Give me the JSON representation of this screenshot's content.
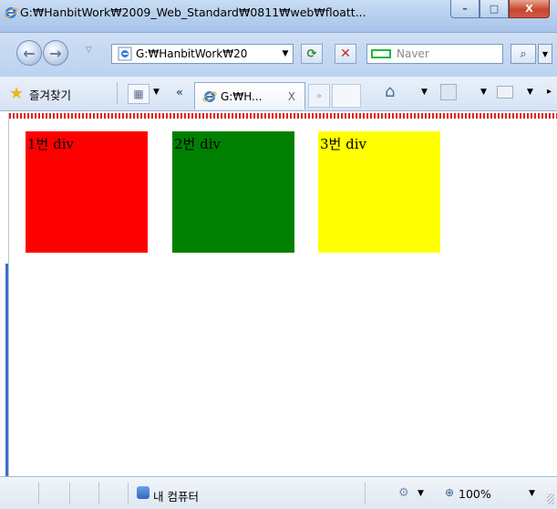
{
  "window": {
    "title": "G:₩HanbitWork₩2009_Web_Standard₩0811₩web₩floatt...",
    "controls": {
      "minimize": "–",
      "maximize": "□",
      "close": "X"
    }
  },
  "nav": {
    "back": "←",
    "forward": "→",
    "address": "G:₩HanbitWork₩20",
    "refresh": "⟳",
    "stop": "✕",
    "search_placeholder": "Naver",
    "search_button": "⌕"
  },
  "toolbar": {
    "favorites_label": "즐겨찾기",
    "tab_scroll": "«",
    "tab_title": "G:₩H...",
    "tab_close": "X",
    "tab_more": "»"
  },
  "page": {
    "boxes": [
      {
        "label": "1번 div",
        "color": "#ff0000"
      },
      {
        "label": "2번 div",
        "color": "#008000"
      },
      {
        "label": "3번 div",
        "color": "#ffff00"
      }
    ]
  },
  "status": {
    "zone": "내 컴퓨터",
    "zoom": "100%"
  }
}
